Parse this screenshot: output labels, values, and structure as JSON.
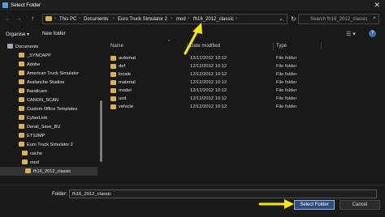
{
  "window": {
    "title": "Select Folder",
    "close_glyph": "✕"
  },
  "nav": {
    "back": "←",
    "forward": "→",
    "up": "↑",
    "breadcrumb": [
      {
        "label": "This PC"
      },
      {
        "label": "Documents"
      },
      {
        "label": "Euro Truck Simulator 2"
      },
      {
        "label": "mod"
      },
      {
        "label": "fh16_2012_classic"
      }
    ],
    "separator": "›",
    "refresh_glyph": "↻",
    "search_placeholder": "Search fh16_2012_classic",
    "search_glyph": "⌕"
  },
  "toolbar": {
    "organise": "Organise ▾",
    "new_folder": "New folder",
    "view_glyph": "☰ ▾",
    "help": "?"
  },
  "sidebar": {
    "items": [
      {
        "label": "Documents"
      },
      {
        "label": "_SYNCAPP"
      },
      {
        "label": "Adobe"
      },
      {
        "label": "American Truck Simulator"
      },
      {
        "label": "Avalanche Studios"
      },
      {
        "label": "Bandicam"
      },
      {
        "label": "CANON_SCAN"
      },
      {
        "label": "Custom Office Templates"
      },
      {
        "label": "CyberLink"
      },
      {
        "label": "Derail_Save_BU"
      },
      {
        "label": "ETS2MP"
      },
      {
        "label": "Euro Truck Simulator 2"
      },
      {
        "label": "cache"
      },
      {
        "label": "mod"
      },
      {
        "label": "fh16_2012_classic"
      }
    ]
  },
  "table": {
    "columns": {
      "name": "Name",
      "date": "Date modified",
      "type": "Type",
      "sort_glyph": "^"
    },
    "rows": [
      {
        "name": "automat",
        "date": "12/12/2012 10:12",
        "type": "File folder"
      },
      {
        "name": "def",
        "date": "12/12/2012 10:12",
        "type": "File folder"
      },
      {
        "name": "locale",
        "date": "12/12/2012 10:12",
        "type": "File folder"
      },
      {
        "name": "material",
        "date": "12/12/2012 10:12",
        "type": "File folder"
      },
      {
        "name": "model",
        "date": "12/12/2012 10:12",
        "type": "File folder"
      },
      {
        "name": "unit",
        "date": "12/12/2012 10:12",
        "type": "File folder"
      },
      {
        "name": "vehicle",
        "date": "12/12/2012 10:12",
        "type": "File folder"
      }
    ]
  },
  "footer": {
    "folder_label": "Folder:",
    "folder_value": "fh16_2012_classic",
    "select_button": "Select Folder",
    "cancel_button": "Cancel"
  },
  "colors": {
    "annotation_arrow": "#f5e900",
    "folder_icon": "#d8b349",
    "primary_button": "#2d4d7a",
    "background": "#191919"
  }
}
